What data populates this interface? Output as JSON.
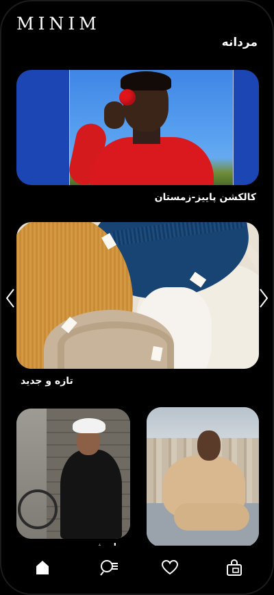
{
  "header": {
    "logo": "MINIM",
    "section_title": "مردانه"
  },
  "banners": [
    {
      "caption": "کالکشن پاییز-زمستان"
    },
    {
      "caption": "تازه و جدید"
    }
  ],
  "products": [
    {
      "caption": "اورشرت"
    }
  ],
  "nav": {
    "items": [
      {
        "icon": "home-icon"
      },
      {
        "icon": "search-filter-icon"
      },
      {
        "icon": "heart-icon"
      },
      {
        "icon": "shopping-bag-icon"
      }
    ]
  },
  "colors": {
    "background": "#000000",
    "text": "#ffffff"
  }
}
